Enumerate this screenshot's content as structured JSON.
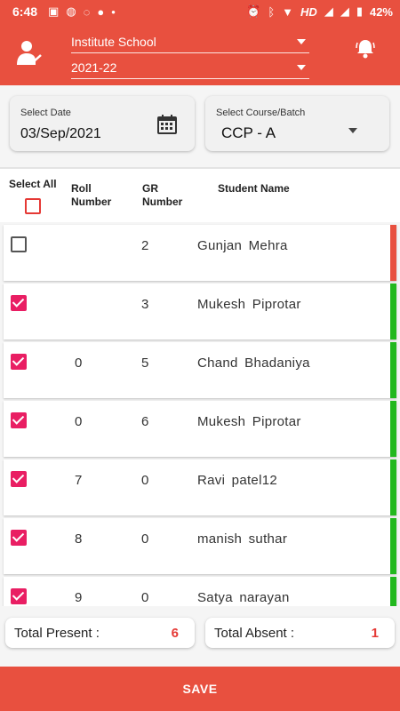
{
  "status_bar": {
    "time": "6:48",
    "network": "HD",
    "battery": "42%"
  },
  "header": {
    "institute": "Institute School",
    "year": "2021-22"
  },
  "filters": {
    "date_label": "Select Date",
    "date_value": "03/Sep/2021",
    "course_label": "Select Course/Batch",
    "course_value": "CCP - A"
  },
  "table": {
    "select_all": "Select All",
    "col_roll_1": "Roll",
    "col_roll_2": "Number",
    "col_gr_1": "GR",
    "col_gr_2": "Number",
    "col_name": "Student Name"
  },
  "students": [
    {
      "roll": "",
      "gr": "2",
      "name": "Gunjan  Mehra",
      "checked": false,
      "status": "absent"
    },
    {
      "roll": "",
      "gr": "3",
      "name": "Mukesh  Piprotar",
      "checked": true,
      "status": "present"
    },
    {
      "roll": "0",
      "gr": "5",
      "name": "Chand  Bhadaniya",
      "checked": true,
      "status": "present"
    },
    {
      "roll": "0",
      "gr": "6",
      "name": "Mukesh  Piprotar",
      "checked": true,
      "status": "present"
    },
    {
      "roll": "7",
      "gr": "0",
      "name": "Ravi  patel12",
      "checked": true,
      "status": "present"
    },
    {
      "roll": "8",
      "gr": "0",
      "name": "manish  suthar",
      "checked": true,
      "status": "present"
    },
    {
      "roll": "9",
      "gr": "0",
      "name": "Satya  narayan",
      "checked": true,
      "status": "present"
    }
  ],
  "totals": {
    "present_label": "Total Present :",
    "present_value": "6",
    "absent_label": "Total Absent :",
    "absent_value": "1"
  },
  "save_label": "SAVE",
  "colors": {
    "brand": "#e8503f",
    "present": "#22b81e",
    "absent": "#e8503f",
    "checkbox": "#e91e63"
  }
}
